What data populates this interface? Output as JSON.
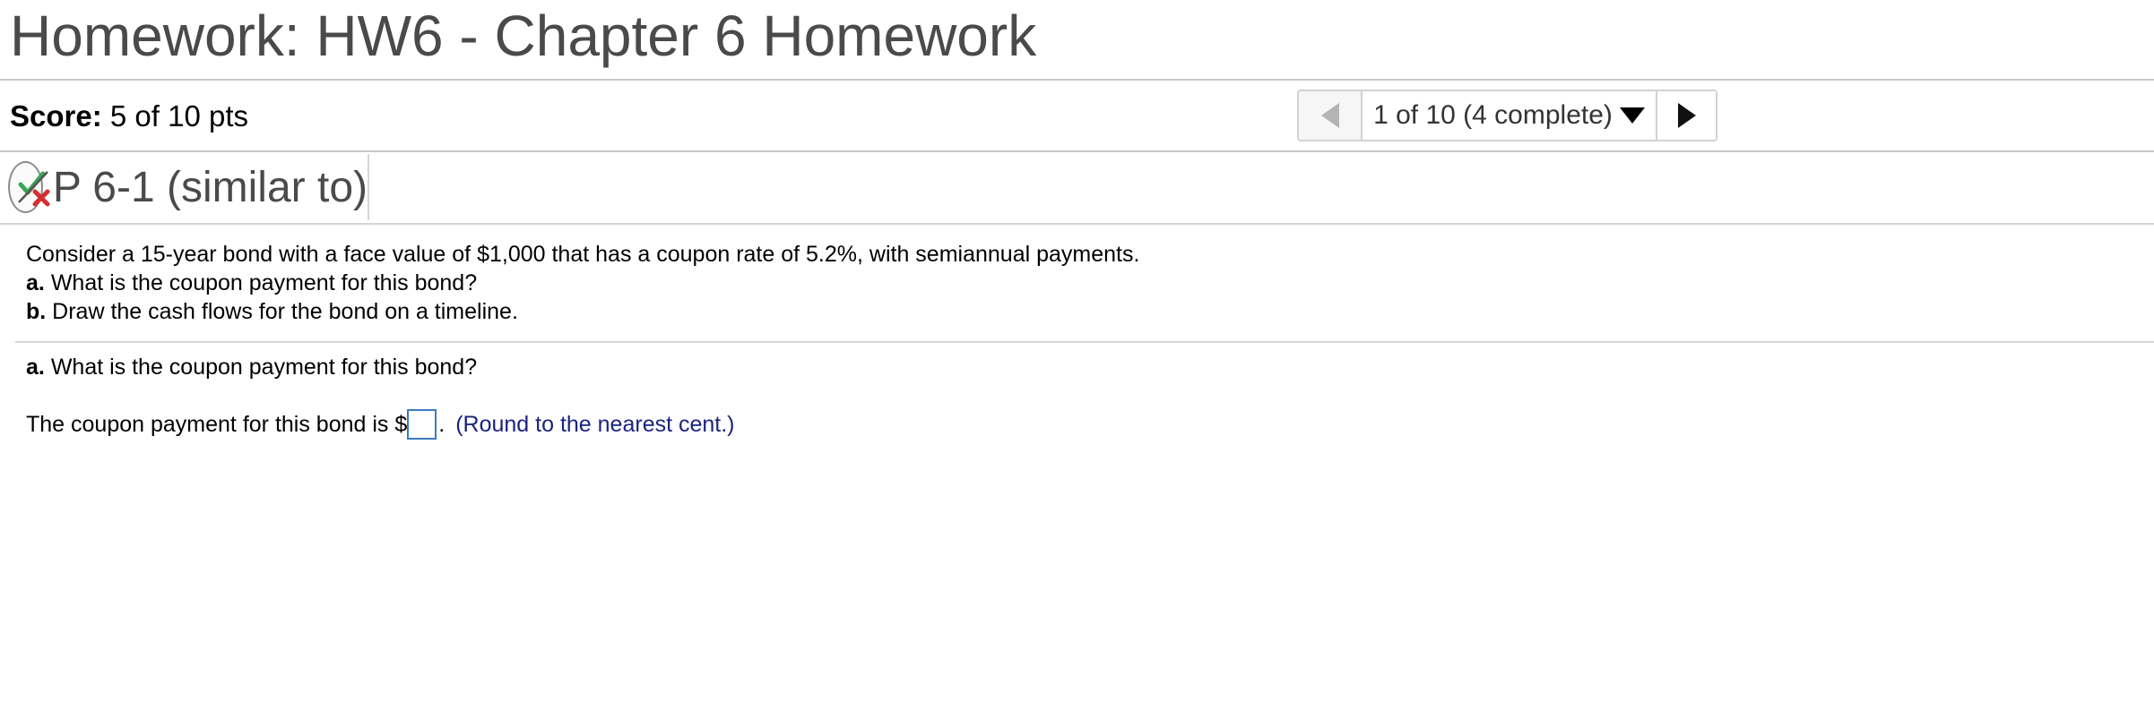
{
  "header": {
    "title": "Homework: HW6 - Chapter 6 Homework"
  },
  "score": {
    "label": "Score:",
    "value": "5 of 10 pts"
  },
  "pager": {
    "position_text": "1 of 10 (4 complete)",
    "prev_icon": "triangle-left-icon",
    "next_icon": "triangle-right-icon",
    "dropdown_icon": "caret-down-icon"
  },
  "question": {
    "title": "P 6-1 (similar to)",
    "status_icon": "partial-correct-icon",
    "prompt": {
      "intro": "Consider a 15-year bond with a face value of $1,000 that has a coupon rate of 5.2%, with semiannual payments.",
      "a_label": "a.",
      "a_text": "What is the coupon payment for this bond?",
      "b_label": "b.",
      "b_text": "Draw the cash flows for the bond on a timeline."
    },
    "current_part": {
      "label": "a.",
      "text": "What is the coupon payment for this bond?"
    },
    "answer": {
      "prefix": "The coupon payment for this bond is $",
      "value": "",
      "suffix": ".",
      "hint": "(Round to the nearest cent.)"
    }
  },
  "colors": {
    "title_gray": "#4a4a4a",
    "hint_blue": "#1a237e",
    "input_border": "#3a7bbf",
    "check_green": "#3aa757",
    "cross_red": "#d32f2f"
  }
}
